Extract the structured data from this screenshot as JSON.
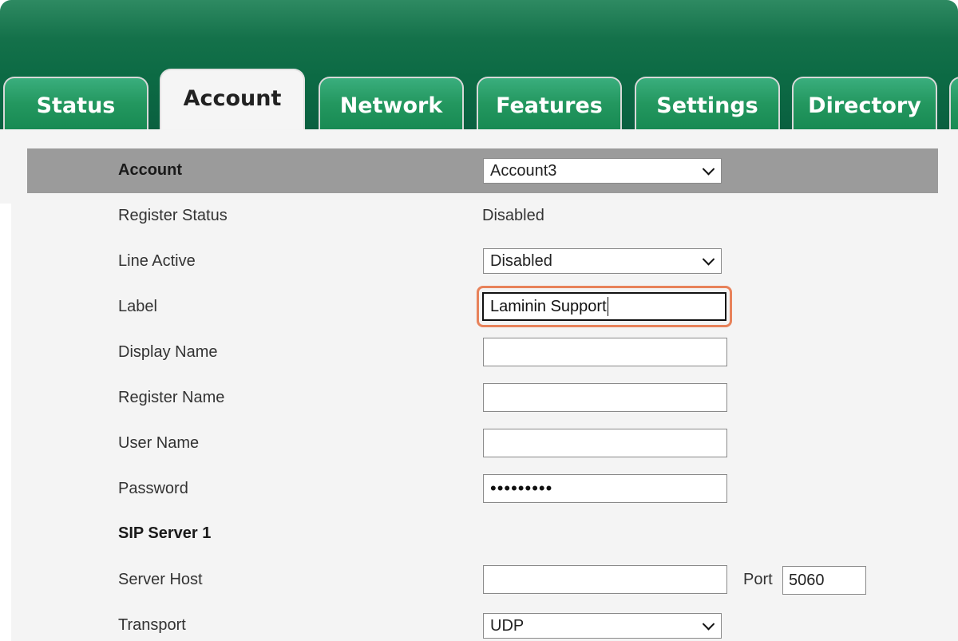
{
  "tabs": [
    {
      "label": "Status"
    },
    {
      "label": "Account",
      "active": true
    },
    {
      "label": "Network"
    },
    {
      "label": "Features"
    },
    {
      "label": "Settings"
    },
    {
      "label": "Directory"
    }
  ],
  "account": {
    "label": "Account",
    "selected": "Account3"
  },
  "fields": {
    "register_status": {
      "label": "Register Status",
      "value": "Disabled"
    },
    "line_active": {
      "label": "Line Active",
      "value": "Disabled"
    },
    "label": {
      "label": "Label",
      "value": "Laminin Support"
    },
    "display_name": {
      "label": "Display Name",
      "value": ""
    },
    "register_name": {
      "label": "Register Name",
      "value": ""
    },
    "user_name": {
      "label": "User Name",
      "value": ""
    },
    "password": {
      "label": "Password",
      "value": "•••••••••"
    }
  },
  "sip_server": {
    "heading": "SIP Server 1",
    "server_host": {
      "label": "Server Host",
      "value": ""
    },
    "port": {
      "label": "Port",
      "value": "5060"
    },
    "transport": {
      "label": "Transport",
      "value": "UDP"
    }
  },
  "colors": {
    "header_green": "#0c6a44",
    "tab_green": "#23975f",
    "focus_ring": "#e8825a",
    "account_bar": "#9b9b9b"
  }
}
